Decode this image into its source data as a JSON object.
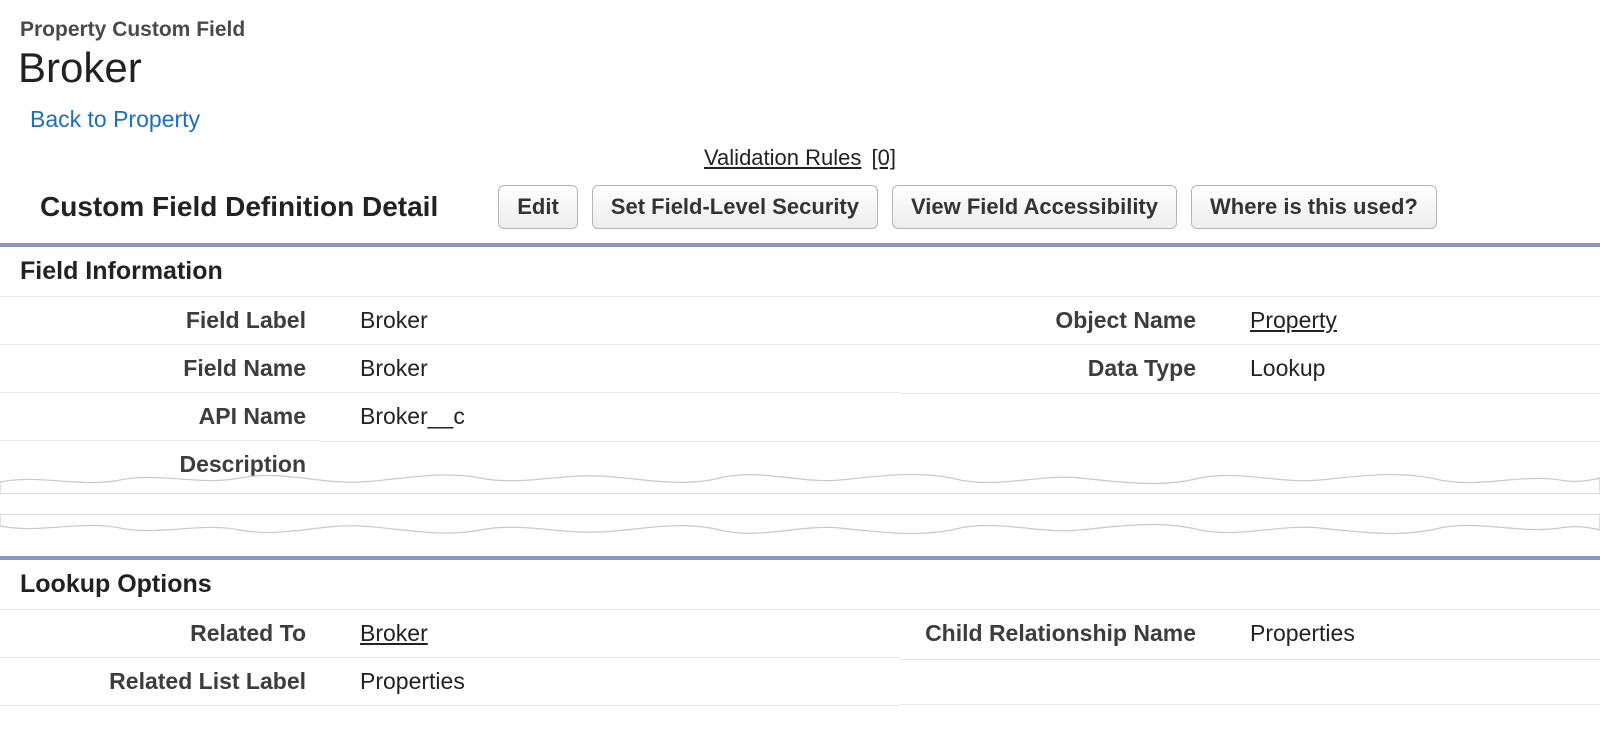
{
  "header": {
    "crumb": "Property Custom Field",
    "title": "Broker",
    "back_link": "Back to Property"
  },
  "anchors": {
    "validation_rules_label": "Validation Rules",
    "validation_rules_count": "[0]"
  },
  "detail": {
    "heading": "Custom Field Definition Detail",
    "buttons": {
      "edit": "Edit",
      "set_fls": "Set Field-Level Security",
      "view_accessibility": "View Field Accessibility",
      "where_used": "Where is this used?"
    }
  },
  "sections": {
    "field_info": {
      "title": "Field Information",
      "rows": {
        "field_label": {
          "label": "Field Label",
          "value": "Broker"
        },
        "object_name": {
          "label": "Object Name",
          "value": "Property"
        },
        "field_name": {
          "label": "Field Name",
          "value": "Broker"
        },
        "data_type": {
          "label": "Data Type",
          "value": "Lookup"
        },
        "api_name": {
          "label": "API Name",
          "value": "Broker__c"
        },
        "description": {
          "label": "Description",
          "value": ""
        }
      }
    },
    "lookup_options": {
      "title": "Lookup Options",
      "rows": {
        "related_to": {
          "label": "Related To",
          "value": "Broker"
        },
        "child_rel_name": {
          "label": "Child Relationship Name",
          "value": "Properties"
        },
        "related_list_label": {
          "label": "Related List Label",
          "value": "Properties"
        }
      }
    }
  }
}
